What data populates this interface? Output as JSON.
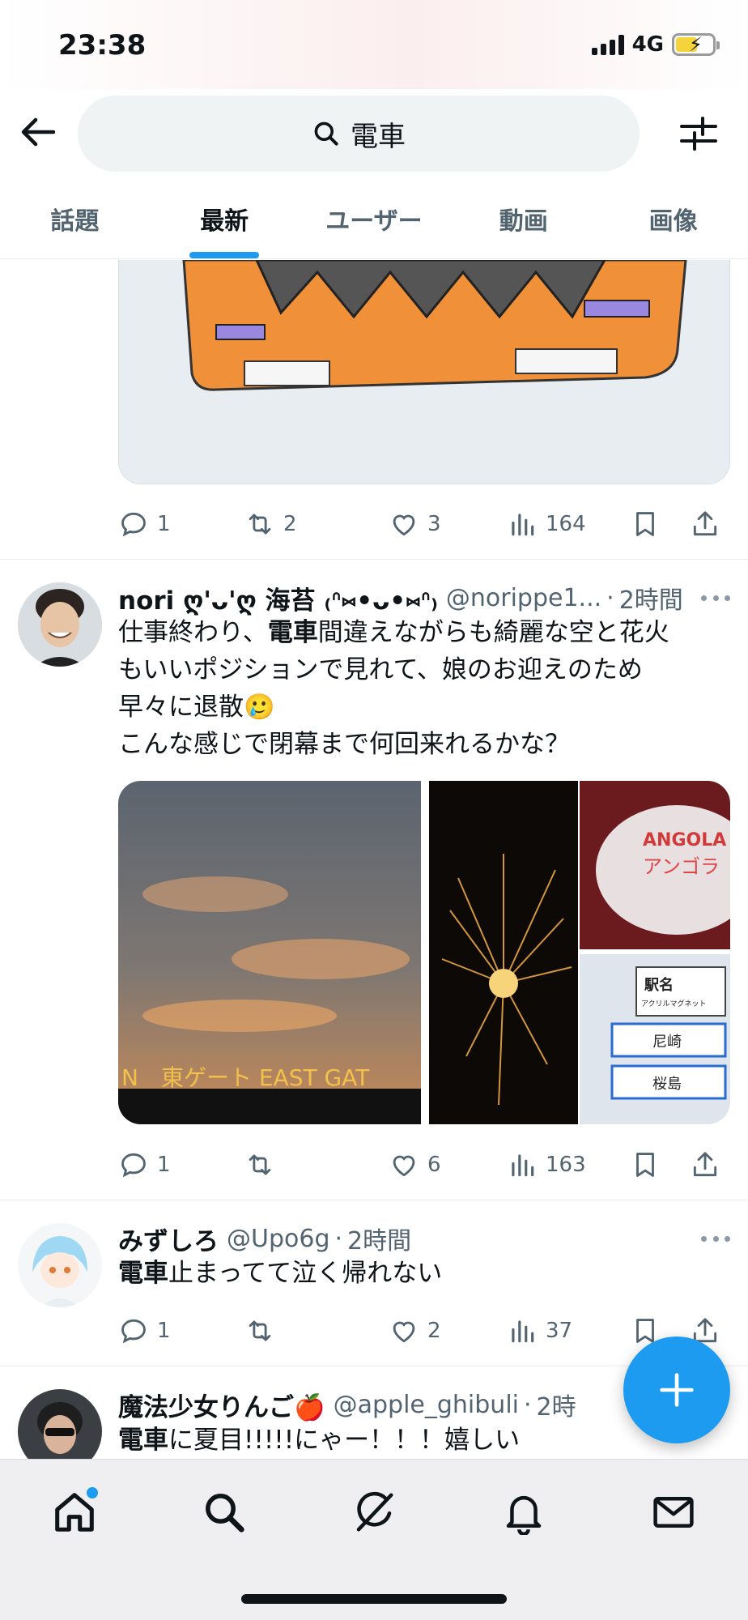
{
  "status_bar": {
    "time": "23:38",
    "network": "4G"
  },
  "search": {
    "query": "電車"
  },
  "tabs": [
    {
      "label": "話題",
      "active": false
    },
    {
      "label": "最新",
      "active": true
    },
    {
      "label": "ユーザー",
      "active": false
    },
    {
      "label": "動画",
      "active": false
    },
    {
      "label": "画像",
      "active": false
    }
  ],
  "tweets": [
    {
      "replies": "1",
      "retweets": "2",
      "likes": "3",
      "views": "164"
    },
    {
      "name": "nori ღ'ᴗ'ღ 海苔 ₍ᐢ⑅•ᴗ•⑅ᐢ₎",
      "handle": "@norippe1...",
      "ago": "2時間",
      "text_lines": [
        "仕事終わり、",
        "電車",
        "間違えながらも綺麗な空と花火",
        "もいいポジションで見れて、娘のお迎えのため",
        "早々に退散🥲",
        "こんな感じで閉幕まで何回来れるかな？"
      ],
      "media_captions": [
        "N　東ゲート EAST GAT",
        "ANGOLA",
        "アンゴラ",
        "駅名",
        "アクリルマグネット",
        "尼崎",
        "桜島"
      ],
      "replies": "1",
      "retweets": "",
      "likes": "6",
      "views": "163"
    },
    {
      "name": "みずしろ",
      "handle": "@Upo6g",
      "ago": "2時間",
      "text_highlight": "電車",
      "text_rest": "止まってて泣く帰れない",
      "replies": "1",
      "retweets": "",
      "likes": "2",
      "views": "37"
    },
    {
      "name": "魔法少女りんご🍎",
      "handle": "@apple_ghibuli",
      "ago": "2時",
      "text_highlight": "電車",
      "text_rest": "に夏目!!!!!にゃー！！！嬉しい"
    }
  ],
  "colors": {
    "accent": "#1d9bf0",
    "text": "#0f1419",
    "muted": "#536471"
  },
  "icons": [
    "back-arrow-icon",
    "search-icon",
    "filter-icon",
    "reply-icon",
    "retweet-icon",
    "like-icon",
    "views-icon",
    "bookmark-icon",
    "share-icon",
    "compose-icon",
    "home-icon",
    "explore-icon",
    "grok-icon",
    "notifications-icon",
    "messages-icon"
  ]
}
